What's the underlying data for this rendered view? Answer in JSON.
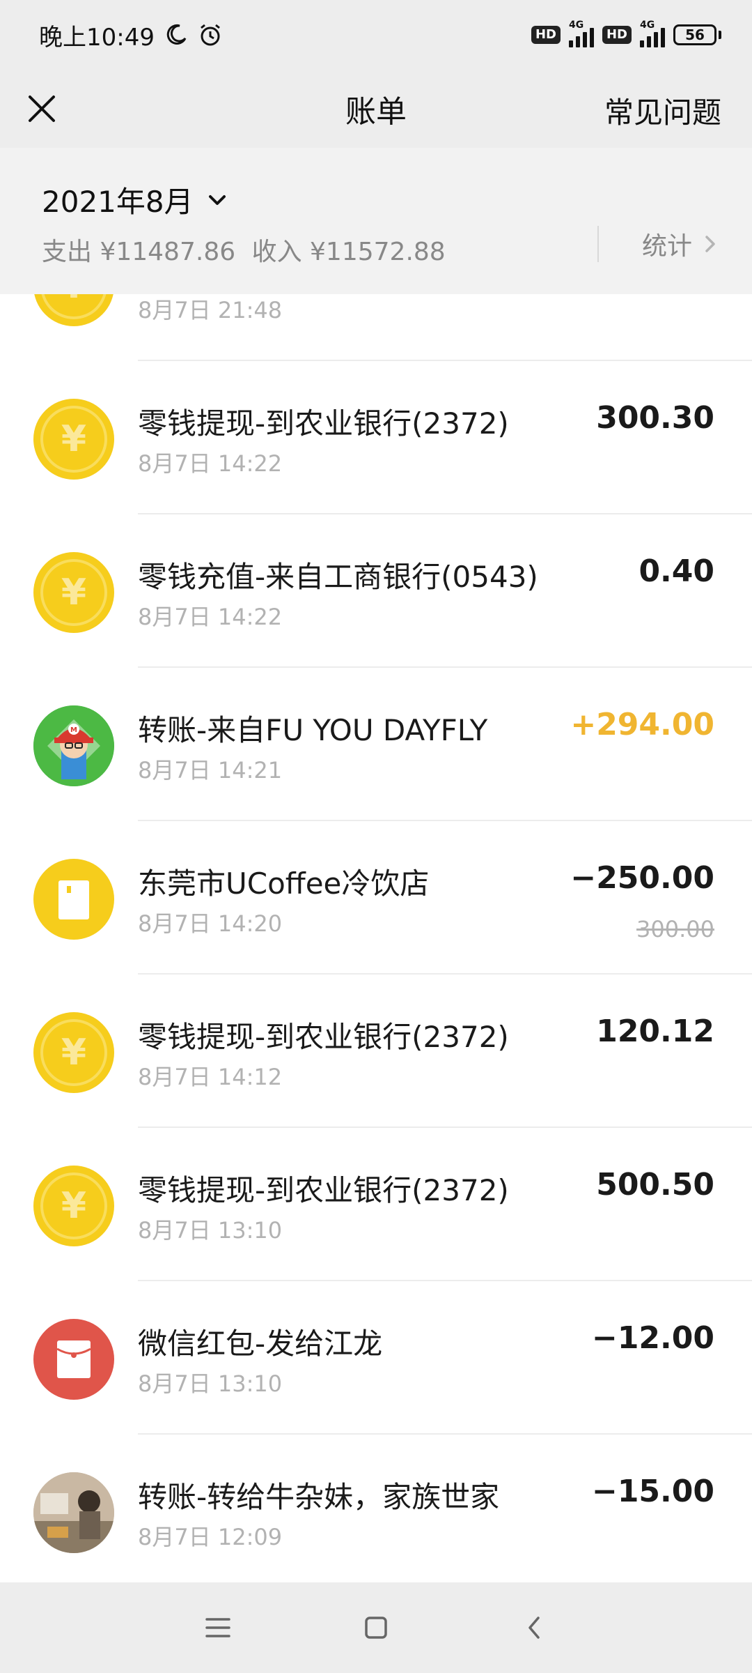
{
  "status_bar": {
    "time": "晚上10:49",
    "hd1": "HD",
    "net1": "4G",
    "hd2": "HD",
    "net2": "4G",
    "battery": "56"
  },
  "header": {
    "title": "账单",
    "faq_label": "常见问题"
  },
  "month_summary": {
    "month": "2021年8月",
    "expense": "支出 ¥11487.86",
    "income": "收入 ¥11572.88",
    "stats_label": "统计"
  },
  "transactions": [
    {
      "title": "",
      "time": "8月7日 21:48",
      "amount": "",
      "icon": "coin-icon"
    },
    {
      "title": "零钱提现-到农业银行(2372)",
      "time": "8月7日 14:22",
      "amount": "300.30",
      "icon": "coin-icon"
    },
    {
      "title": "零钱充值-来自工商银行(0543)",
      "time": "8月7日 14:22",
      "amount": "0.40",
      "icon": "coin-icon"
    },
    {
      "title": "转账-来自FU YOU DAYFLY",
      "time": "8月7日 14:21",
      "amount": "+294.00",
      "icon": "user-avatar"
    },
    {
      "title": "东莞市UCoffee冷饮店",
      "time": "8月7日 14:20",
      "amount": "−250.00",
      "original_amount": "300.00",
      "icon": "shop-bag-icon"
    },
    {
      "title": "零钱提现-到农业银行(2372)",
      "time": "8月7日 14:12",
      "amount": "120.12",
      "icon": "coin-icon"
    },
    {
      "title": "零钱提现-到农业银行(2372)",
      "time": "8月7日 13:10",
      "amount": "500.50",
      "icon": "coin-icon"
    },
    {
      "title": "微信红包-发给江龙",
      "time": "8月7日 13:10",
      "amount": "−12.00",
      "icon": "red-packet-icon"
    },
    {
      "title": "转账-转给牛杂妹，家族世家",
      "time": "8月7日 12:09",
      "amount": "−15.00",
      "icon": "user-avatar"
    }
  ],
  "colors": {
    "income": "#f0b531",
    "coin": "#f6cd1c",
    "red_packet": "#e0554a",
    "header_bg": "#ededed"
  },
  "nav": {
    "menu_icon": "menu-icon",
    "home_icon": "home-icon",
    "back_icon": "back-icon"
  }
}
